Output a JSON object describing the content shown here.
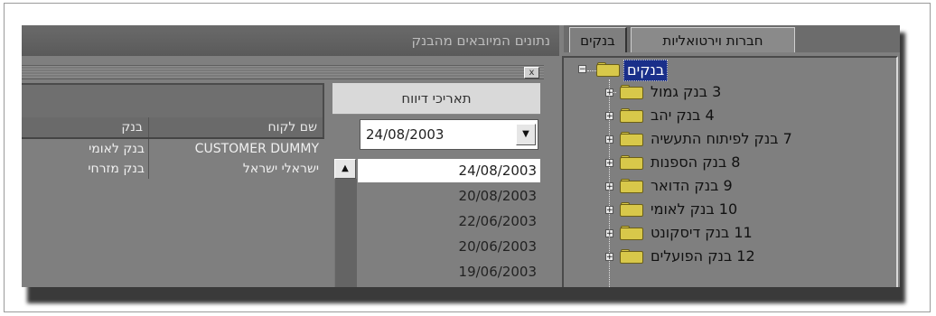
{
  "left_panel": {
    "title": "נתונים המיובאים מהבנק",
    "close_symbol": "x",
    "grid": {
      "columns": [
        "שם לקוח",
        "בנק"
      ],
      "rows": [
        [
          "CUSTOMER DUMMY",
          "בנק לאומי"
        ],
        [
          "ישראלי ישראל",
          "בנק מזרחי"
        ]
      ]
    },
    "dates": {
      "header": "תאריכי דיווח",
      "selected": "24/08/2003",
      "combo_arrow": "▼",
      "scroll_up": "▲",
      "items": [
        "24/08/2003",
        "20/08/2003",
        "22/06/2003",
        "20/06/2003",
        "19/06/2003"
      ]
    }
  },
  "right_panel": {
    "tabs": [
      {
        "label": "בנקים",
        "active": true
      },
      {
        "label": "חברות וירטואליות",
        "active": false
      }
    ],
    "tree": {
      "root": "בנקים",
      "items": [
        "3 בנק גמול",
        "4 בנק יהב",
        "7 בנק לפיתוח התעשיה",
        "8 בנק הספנות",
        "9 בנק הדואר",
        "10 בנק לאומי",
        "11 בנק דיסקונט",
        "12 בנק הפועלים"
      ]
    }
  },
  "colors": {
    "panel_bg": "#7f7f7f",
    "selection_bg": "#1a2f8a",
    "folder": "#d8c84a"
  }
}
